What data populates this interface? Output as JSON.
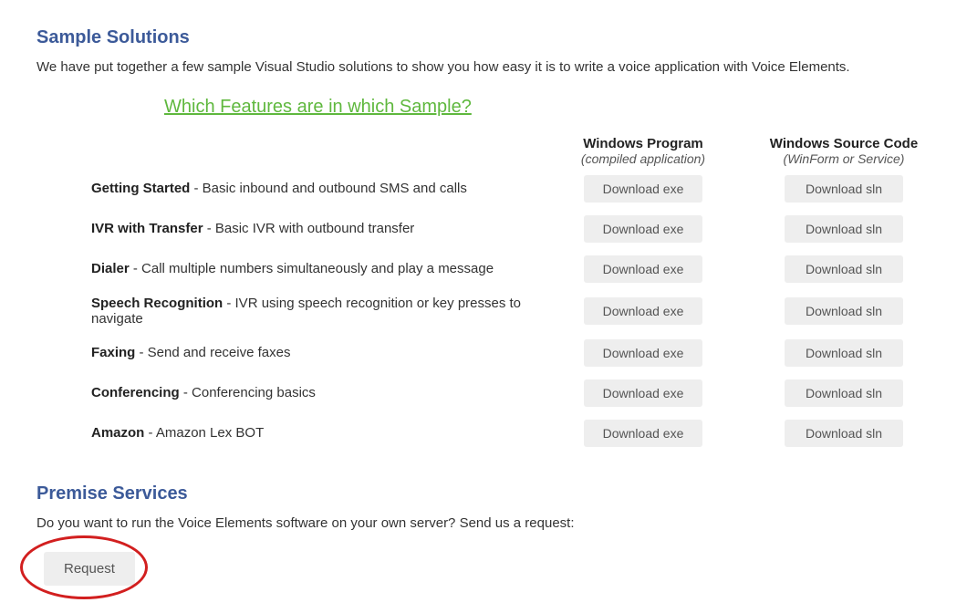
{
  "sample_solutions": {
    "title": "Sample Solutions",
    "intro": "We have put together a few sample Visual Studio solutions to show you how easy it is to write a voice application with Voice Elements.",
    "features_link": "Which Features are in which Sample?",
    "columns": {
      "program": {
        "title": "Windows Program",
        "subtitle": "(compiled application)",
        "button_label": "Download exe"
      },
      "source": {
        "title": "Windows Source Code",
        "subtitle": "(WinForm or Service)",
        "button_label": "Download sln"
      }
    },
    "rows": [
      {
        "name": "Getting Started",
        "desc": " - Basic inbound and outbound SMS and calls"
      },
      {
        "name": "IVR with Transfer",
        "desc": " - Basic IVR with outbound transfer"
      },
      {
        "name": "Dialer",
        "desc": " - Call multiple numbers simultaneously and play a message"
      },
      {
        "name": "Speech Recognition",
        "desc": " - IVR using speech recognition or key presses to navigate"
      },
      {
        "name": "Faxing",
        "desc": " - Send and receive faxes"
      },
      {
        "name": "Conferencing",
        "desc": " - Conferencing basics"
      },
      {
        "name": "Amazon",
        "desc": " - Amazon Lex BOT"
      }
    ]
  },
  "premise": {
    "title": "Premise Services",
    "text": "Do you want to run the Voice Elements software on your own server? Send us a request:",
    "button_label": "Request"
  }
}
